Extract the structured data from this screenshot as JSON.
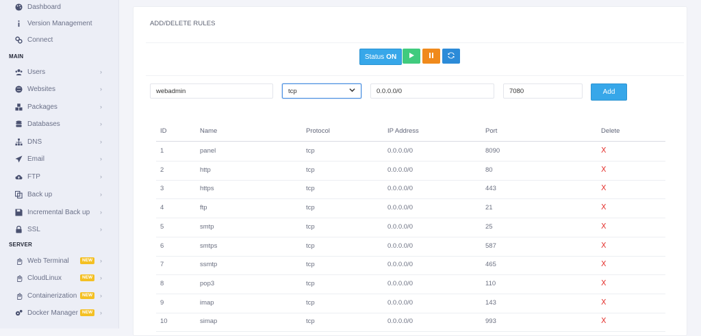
{
  "sidebar": {
    "top_items": [
      {
        "label": "Dashboard",
        "icon": "palette-icon"
      },
      {
        "label": "Version Management",
        "icon": "info-icon"
      },
      {
        "label": "Connect",
        "icon": "link-icon"
      }
    ],
    "main_header": "MAIN",
    "main_items": [
      {
        "label": "Users",
        "icon": "users-icon"
      },
      {
        "label": "Websites",
        "icon": "globe-icon"
      },
      {
        "label": "Packages",
        "icon": "cubes-icon"
      },
      {
        "label": "Databases",
        "icon": "database-icon"
      },
      {
        "label": "DNS",
        "icon": "sitemap-icon"
      },
      {
        "label": "Email",
        "icon": "paper-plane-icon"
      },
      {
        "label": "FTP",
        "icon": "cloud-upload-icon"
      },
      {
        "label": "Back up",
        "icon": "copy-icon"
      },
      {
        "label": "Incremental Back up",
        "icon": "save-icon"
      },
      {
        "label": "SSL",
        "icon": "lock-icon"
      }
    ],
    "server_header": "SERVER",
    "server_items": [
      {
        "label": "Web Terminal",
        "icon": "hand-icon",
        "badge": "NEW"
      },
      {
        "label": "CloudLinux",
        "icon": "hand-icon",
        "badge": "NEW"
      },
      {
        "label": "Containerization",
        "icon": "hand-icon",
        "badge": "NEW"
      },
      {
        "label": "Docker Manager",
        "icon": "cogs-icon",
        "badge": "NEW"
      }
    ]
  },
  "card": {
    "title": "ADD/DELETE RULES",
    "status_prefix": "Status",
    "status_value": "ON"
  },
  "form": {
    "name_value": "webadmin",
    "protocol_value": "tcp",
    "ip_value": "0.0.0.0/0",
    "port_value": "7080",
    "add_label": "Add"
  },
  "table": {
    "headers": [
      "ID",
      "Name",
      "Protocol",
      "IP Address",
      "Port",
      "Delete"
    ],
    "rows": [
      {
        "id": "1",
        "name": "panel",
        "protocol": "tcp",
        "ip": "0.0.0.0/0",
        "port": "8090",
        "del": "X"
      },
      {
        "id": "2",
        "name": "http",
        "protocol": "tcp",
        "ip": "0.0.0.0/0",
        "port": "80",
        "del": "X"
      },
      {
        "id": "3",
        "name": "https",
        "protocol": "tcp",
        "ip": "0.0.0.0/0",
        "port": "443",
        "del": "X"
      },
      {
        "id": "4",
        "name": "ftp",
        "protocol": "tcp",
        "ip": "0.0.0.0/0",
        "port": "21",
        "del": "X"
      },
      {
        "id": "5",
        "name": "smtp",
        "protocol": "tcp",
        "ip": "0.0.0.0/0",
        "port": "25",
        "del": "X"
      },
      {
        "id": "6",
        "name": "smtps",
        "protocol": "tcp",
        "ip": "0.0.0.0/0",
        "port": "587",
        "del": "X"
      },
      {
        "id": "7",
        "name": "ssmtp",
        "protocol": "tcp",
        "ip": "0.0.0.0/0",
        "port": "465",
        "del": "X"
      },
      {
        "id": "8",
        "name": "pop3",
        "protocol": "tcp",
        "ip": "0.0.0.0/0",
        "port": "110",
        "del": "X"
      },
      {
        "id": "9",
        "name": "imap",
        "protocol": "tcp",
        "ip": "0.0.0.0/0",
        "port": "143",
        "del": "X"
      },
      {
        "id": "10",
        "name": "simap",
        "protocol": "tcp",
        "ip": "0.0.0.0/0",
        "port": "993",
        "del": "X"
      }
    ]
  },
  "colors": {
    "accent": "#37a7e9",
    "play": "#40cb7e",
    "pause": "#f08a1c",
    "refresh": "#2c8bd8",
    "delete": "#e53935",
    "badge": "#f4c023"
  }
}
